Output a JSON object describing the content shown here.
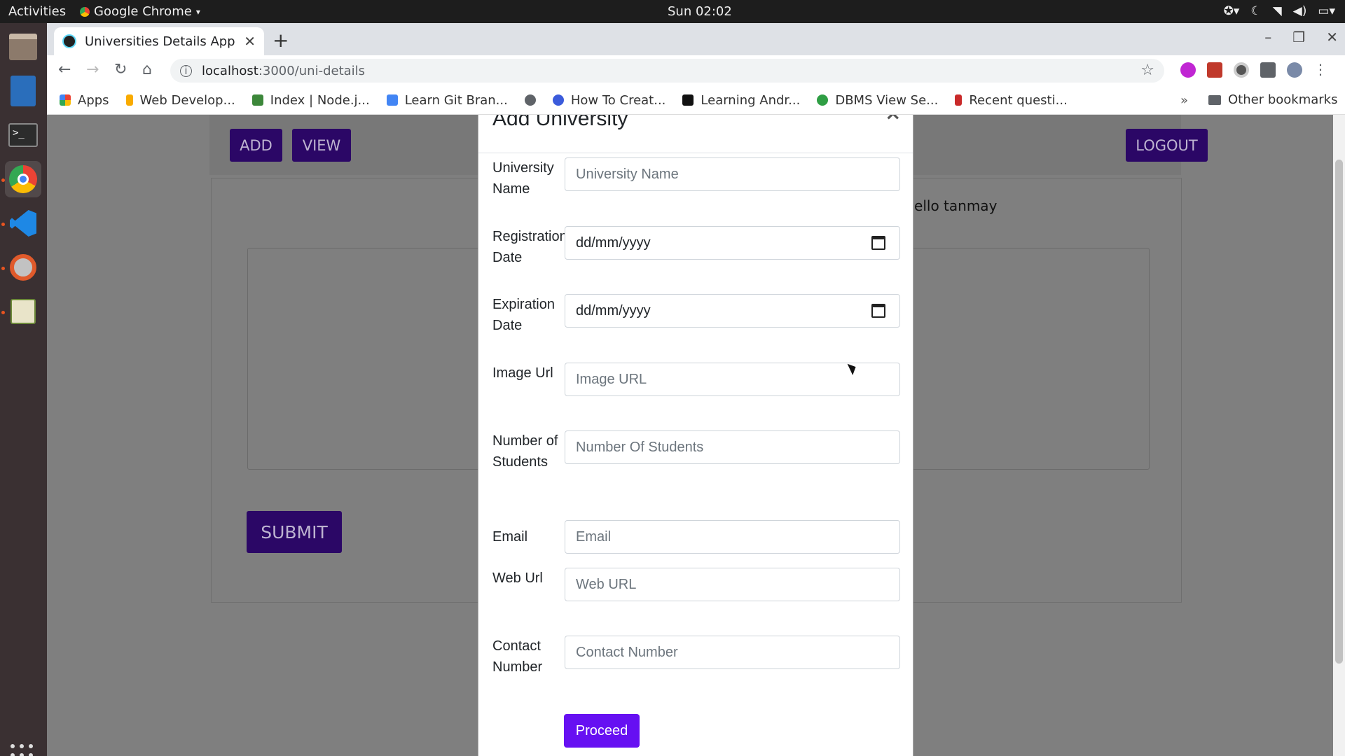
{
  "topbar": {
    "activities": "Activities",
    "app_menu": "Google Chrome",
    "clock": "Sun 02:02"
  },
  "dock": {
    "items": [
      "files-icon",
      "writer-icon",
      "terminal-icon",
      "chrome-icon",
      "vscode-icon",
      "settings-icon",
      "editor-icon"
    ]
  },
  "browser": {
    "tab_title": "Universities Details App",
    "url_host": "localhost",
    "url_path": ":3000/uni-details",
    "bookmarks": [
      {
        "label": "Apps",
        "color": "#ea4335"
      },
      {
        "label": "Web Develop...",
        "color": "#f9ab00"
      },
      {
        "label": "Index | Node.j...",
        "color": "#3c873a"
      },
      {
        "label": "Learn Git Bran...",
        "color": "#4285f4"
      },
      {
        "label": "",
        "color": "#5f6368"
      },
      {
        "label": "How To Creat...",
        "color": "#3b5bdb"
      },
      {
        "label": "Learning Andr...",
        "color": "#111111"
      },
      {
        "label": "DBMS View Se...",
        "color": "#2f9e44"
      },
      {
        "label": "Recent questi...",
        "color": "#c92a2a"
      }
    ],
    "more_bookmarks": "»",
    "other_bookmarks": "Other bookmarks"
  },
  "page": {
    "add_button": "ADD",
    "view_button": "VIEW",
    "logout_button": "LOGOUT",
    "greeting": "Hello tanmay",
    "submit_button": "SUBMIT"
  },
  "modal": {
    "title": "Add University",
    "close": "×",
    "fields": {
      "university_name": {
        "label": "University Name",
        "placeholder": "University Name"
      },
      "registration_date": {
        "label": "Registration Date",
        "value": "dd/mm/yyyy"
      },
      "expiration_date": {
        "label": "Expiration Date",
        "value": "dd/mm/yyyy"
      },
      "image_url": {
        "label": "Image Url",
        "placeholder": "Image URL"
      },
      "num_students": {
        "label": "Number of Students",
        "placeholder": "Number Of Students"
      },
      "email": {
        "label": "Email",
        "placeholder": "Email"
      },
      "web_url": {
        "label": "Web Url",
        "placeholder": "Web URL"
      },
      "contact_number": {
        "label": "Contact Number",
        "placeholder": "Contact Number"
      }
    },
    "proceed_button": "Proceed"
  },
  "colors": {
    "brand_button": "#6610f2",
    "dimmed_button": "#2b0766"
  }
}
